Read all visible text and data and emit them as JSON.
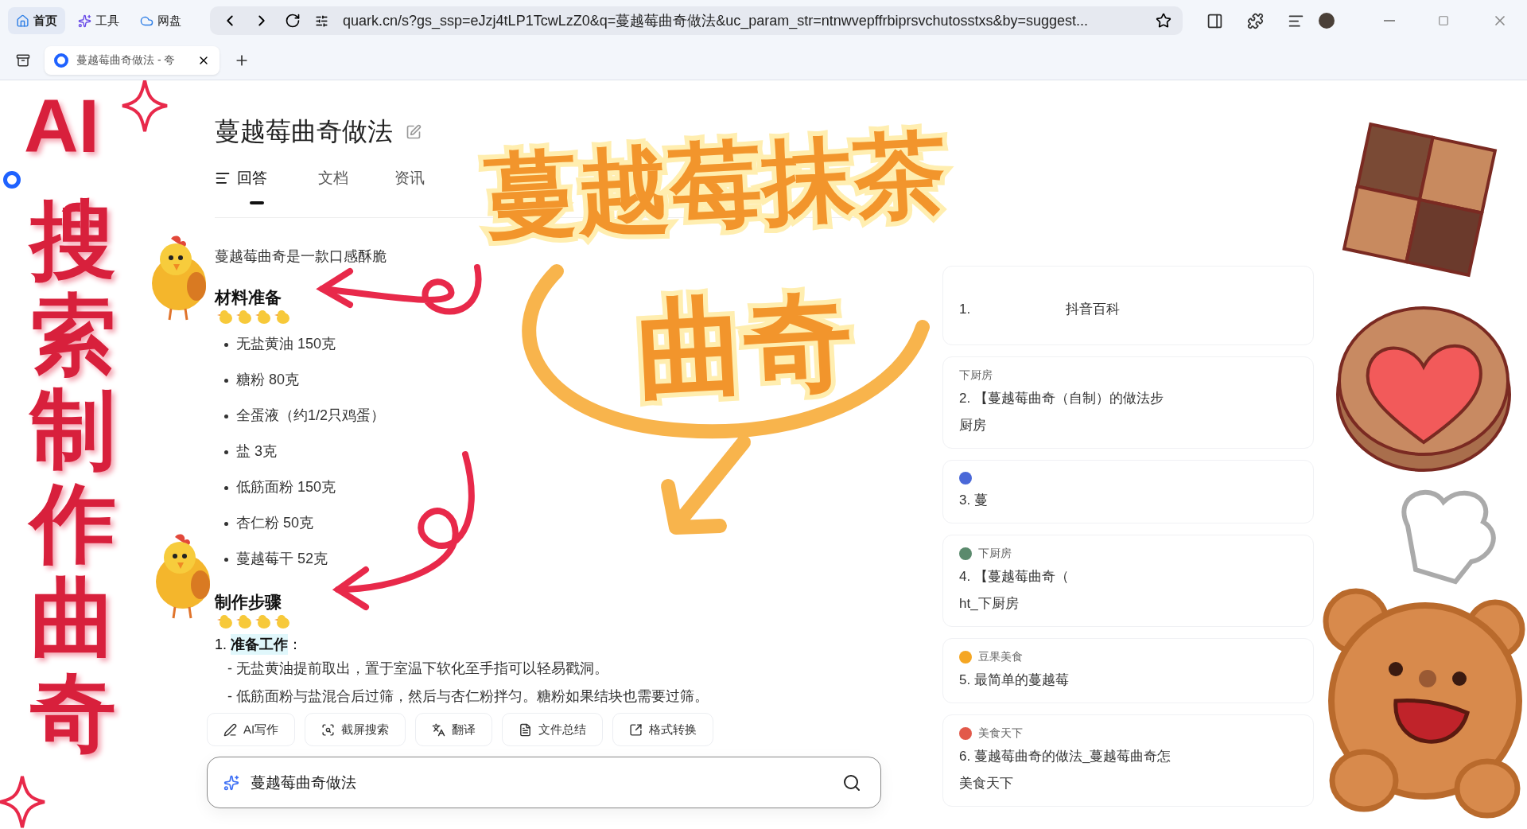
{
  "browser": {
    "nav": [
      {
        "label": "首页",
        "selected": true
      },
      {
        "label": "工具",
        "selected": false
      },
      {
        "label": "网盘",
        "selected": false
      }
    ],
    "url": "quark.cn/s?gs_ssp=eJzj4tLP1TcwLzZ0&q=蔓越莓曲奇做法&uc_param_str=ntnwvepffrbiprsvchutosstxs&by=suggest...",
    "tab": {
      "title": "蔓越莓曲奇做法 - 夸",
      "selected": true
    }
  },
  "answer": {
    "title": "蔓越莓曲奇做法",
    "tabs": [
      {
        "label": "回答",
        "selected": true
      },
      {
        "label": "文档",
        "selected": false
      },
      {
        "label": "资讯",
        "selected": false
      }
    ],
    "intro": "蔓越莓曲奇是一款口感酥脆",
    "ingredients": {
      "heading": "材料准备",
      "items": [
        "无盐黄油 150克",
        "糖粉 80克",
        "全蛋液（约1/2只鸡蛋）",
        "盐 3克",
        "低筋面粉 150克",
        "杏仁粉 50克",
        "蔓越莓干 52克"
      ]
    },
    "steps": {
      "heading": "制作步骤",
      "step_number": "1.",
      "step_title": "准备工作",
      "step_colon": "：",
      "lines": [
        "- 无盐黄油提前取出，置于室温下软化至手指可以轻易戳洞。",
        "- 低筋面粉与盐混合后过筛，然后与杏仁粉拌匀。糖粉如果结块也需要过筛。"
      ]
    }
  },
  "tools": [
    "AI写作",
    "截屏搜索",
    "翻译",
    "文件总结",
    "格式转换"
  ],
  "search": {
    "value": "蔓越莓曲奇做法"
  },
  "sources": [
    {
      "logo": false,
      "title": "1.",
      "title_tail": "抖音百科"
    },
    {
      "logo": false,
      "source": "下厨房",
      "title": "2. 【蔓越莓曲奇（自制）的做法步",
      "line2": "厨房"
    },
    {
      "logo": true,
      "title": "3. 蔓"
    },
    {
      "logo": true,
      "source": "下厨房",
      "title": "4. 【蔓越莓曲奇（",
      "line2": "ht_下厨房"
    },
    {
      "logo": true,
      "source": "豆果美食",
      "title": "5. 最简单的蔓越莓"
    },
    {
      "logo": true,
      "source": "美食天下",
      "title": "6. 蔓越莓曲奇的做法_蔓越莓曲奇怎",
      "line2": "美食天下"
    }
  ],
  "overlay": {
    "side_title": [
      "AI",
      "搜索制作曲奇"
    ],
    "big_title": [
      "蔓越莓抹茶",
      "曲奇"
    ]
  }
}
